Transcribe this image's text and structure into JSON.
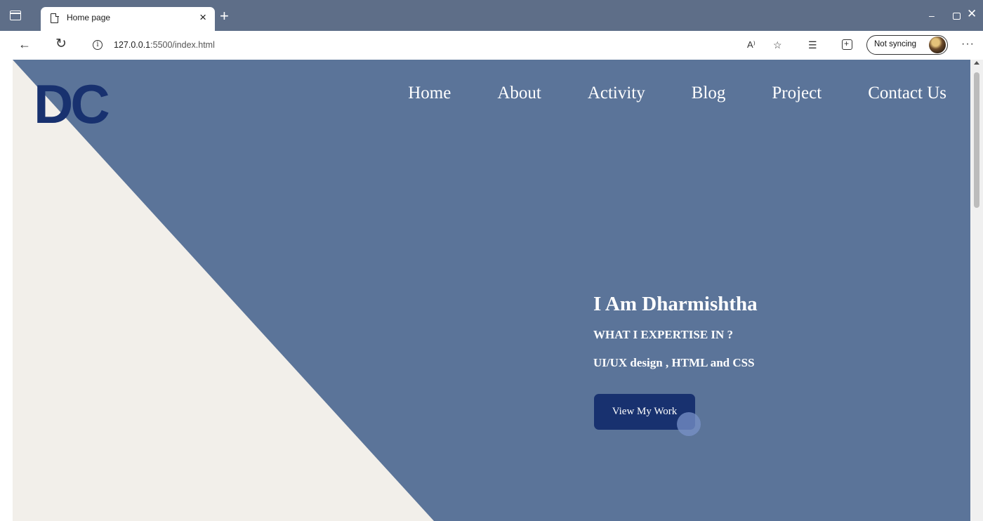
{
  "browser": {
    "tab": {
      "title": "Home page",
      "close_glyph": "×"
    },
    "new_tab_glyph": "+",
    "window": {
      "minimize_glyph": "–",
      "close_glyph": "✕"
    },
    "address": {
      "url_host": "127.0.0.1",
      "url_rest": ":5500/index.html",
      "info_glyph": "i"
    },
    "toolbar_glyphs": {
      "back": "←",
      "reload": "↻",
      "read_aloud": "A⁾",
      "favorite": "☆",
      "favorites_bar": "☰",
      "more": "···"
    },
    "sync_label": "Not syncing"
  },
  "site": {
    "logo": "DC",
    "nav": [
      "Home",
      "About",
      "Activity",
      "Blog",
      "Project",
      "Contact Us"
    ],
    "hero": {
      "title": "I Am Dharmishtha",
      "subtitle": "WHAT I EXPERTISE IN ?",
      "skills": "UI/UX design , HTML and CSS",
      "cta_label": "View My Work"
    }
  },
  "colors": {
    "hero_background": "#5b7499",
    "diagonal_panel": "#f2efea",
    "brand_navy": "#18316f",
    "tab_strip": "#5e6e88"
  },
  "icons": [
    "tab-actions-icon",
    "page-icon",
    "close-icon",
    "plus-icon",
    "back-icon",
    "reload-icon",
    "info-icon",
    "read-aloud-icon",
    "favorite-icon",
    "favorites-bar-icon",
    "collections-icon",
    "avatar",
    "more-icon"
  ]
}
